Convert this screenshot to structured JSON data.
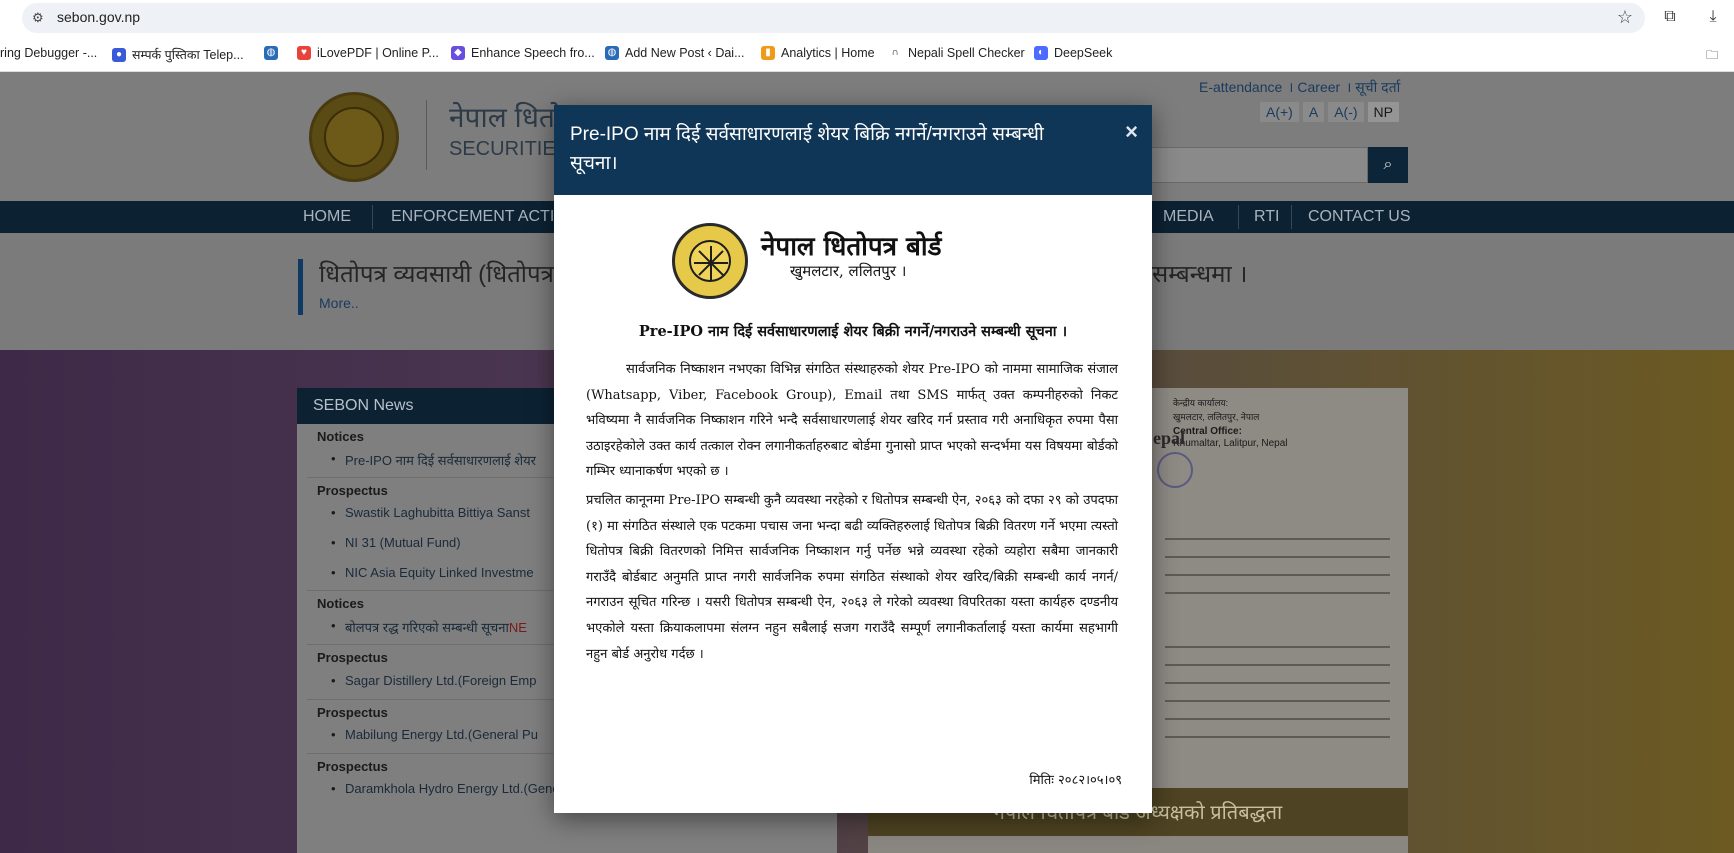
{
  "browser": {
    "url": "sebon.gov.np",
    "bookmarks": [
      {
        "label": "ring Debugger -..."
      },
      {
        "label": "सम्पर्क पुस्तिका Telep..."
      },
      {
        "label": ""
      },
      {
        "label": "iLovePDF | Online P..."
      },
      {
        "label": "Enhance Speech fro..."
      },
      {
        "label": "Add New Post ‹ Dai..."
      },
      {
        "label": "Analytics | Home"
      },
      {
        "label": "Nepali Spell Checker"
      },
      {
        "label": "DeepSeek"
      }
    ]
  },
  "site": {
    "title_ne": "नेपाल धितो",
    "title_en": "SECURITIES",
    "top_links": [
      "E-attendance",
      "Career",
      "सूची दर्ता"
    ],
    "font_buttons": [
      "A(+)",
      "A",
      "A(-)",
      "NP"
    ],
    "nav": [
      "HOME",
      "ENFORCEMENT ACTIO",
      "MEDIA",
      "RTI",
      "CONTACT US"
    ],
    "headline_left": "धितोपत्र व्यवसायी (धितोपत्र",
    "headline_right": "सम्बन्धमा ।",
    "headline_more": "More..",
    "news": {
      "title": "SEBON News",
      "groups": [
        {
          "category": "Notices",
          "items": [
            "Pre-IPO नाम दिई सर्वसाधारणलाई शेयर"
          ]
        },
        {
          "category": "Prospectus",
          "items": [
            "Swastik Laghubitta Bittiya Sanst",
            "NI 31 (Mutual Fund)",
            "NIC Asia Equity Linked Investme"
          ]
        },
        {
          "category": "Notices",
          "items": [
            "बोलपत्र रद्ध गरिएको सम्बन्धी सूचना"
          ],
          "new_tag": "NE"
        },
        {
          "category": "Prospectus",
          "items": [
            "Sagar Distillery Ltd.(Foreign Emp"
          ]
        },
        {
          "category": "Prospectus",
          "items": [
            "Mabilung Energy Ltd.(General Pu"
          ]
        },
        {
          "category": "Prospectus",
          "items": [
            "Daramkhola Hydro Energy Ltd.(General Public)"
          ]
        }
      ]
    },
    "right_caption": "नेपाल धितोपत्र बोर्ड अध्यक्षको प्रतिबद्धता",
    "right_doc_fragments": [
      "केन्द्रीय कार्यालय:",
      "खुमलटार, ललितपुर, नेपाल",
      "Central Office:",
      "Khumaltar, Lalitpur, Nepal",
      "epal"
    ]
  },
  "modal": {
    "title": "Pre-IPO नाम दिई सर्वसाधारणलाई शेयर बिक्रि नगर्ने/नगराउने सम्बन्धी सूचना।",
    "close": "×",
    "org_name": "नेपाल धितोपत्र बोर्ड",
    "org_address": "खुमलटार, ललितपुर ।",
    "heading": "Pre-IPO नाम दिई सर्वसाधारणलाई शेयर बिक्री नगर्ने/नगराउने सम्बन्धी सूचना ।",
    "paragraph1": "सार्वजनिक निष्काशन नभएका विभिन्न संगठित संस्थाहरुको शेयर Pre-IPO को नाममा सामाजिक संजाल (Whatsapp, Viber, Facebook Group), Email तथा SMS मार्फत् उक्त कम्पनीहरुको निकट भविष्यमा नै सार्वजनिक निष्काशन गरिने भन्दै सर्वसाधारणलाई शेयर खरिद गर्न प्रस्ताव गरी अनाधिकृत रुपमा पैसा उठाइरहेकोले उक्त कार्य तत्काल रोक्न लगानीकर्ताहरुबाट बोर्डमा गुनासो प्राप्त भएको सन्दर्भमा यस विषयमा बोर्डको गम्भिर ध्यानाकर्षण भएको छ ।",
    "paragraph2": "प्रचलित कानूनमा Pre-IPO सम्बन्धी कुनै व्यवस्था नरहेको र धितोपत्र सम्बन्धी ऐन, २०६३ को दफा २९ को उपदफा (१) मा संगठित संस्थाले एक पटकमा पचास जना भन्दा बढी व्यक्तिहरुलाई धितोपत्र बिक्री वितरण गर्ने भएमा त्यस्तो धितोपत्र बिक्री वितरणको निमित्त सार्वजनिक निष्काशन गर्नु पर्नेछ भन्ने व्यवस्था रहेको व्यहोरा सबैमा जानकारी गराउँदै बोर्डबाट अनुमति प्राप्त नगरी सार्वजनिक रुपमा संगठित संस्थाको शेयर खरिद/बिक्री सम्बन्धी कार्य नगर्न/नगराउन सूचित गरिन्छ । यसरी धितोपत्र सम्बन्धी ऐन, २०६३ ले गरेको व्यवस्था विपरितका यस्ता कार्यहरु दण्डनीय भएकोले यस्ता क्रियाकलापमा संलग्न नहुन सबैलाई सजग गराउँदै सम्पूर्ण लगानीकर्तालाई यस्ता कार्यमा सहभागी नहुन बोर्ड अनुरोध गर्दछ ।",
    "date": "मितिः २०८२।०५।०९"
  },
  "colors": {
    "modal_header": "#0f3657",
    "navbar": "#0c2233",
    "link": "#1a3a5e"
  }
}
